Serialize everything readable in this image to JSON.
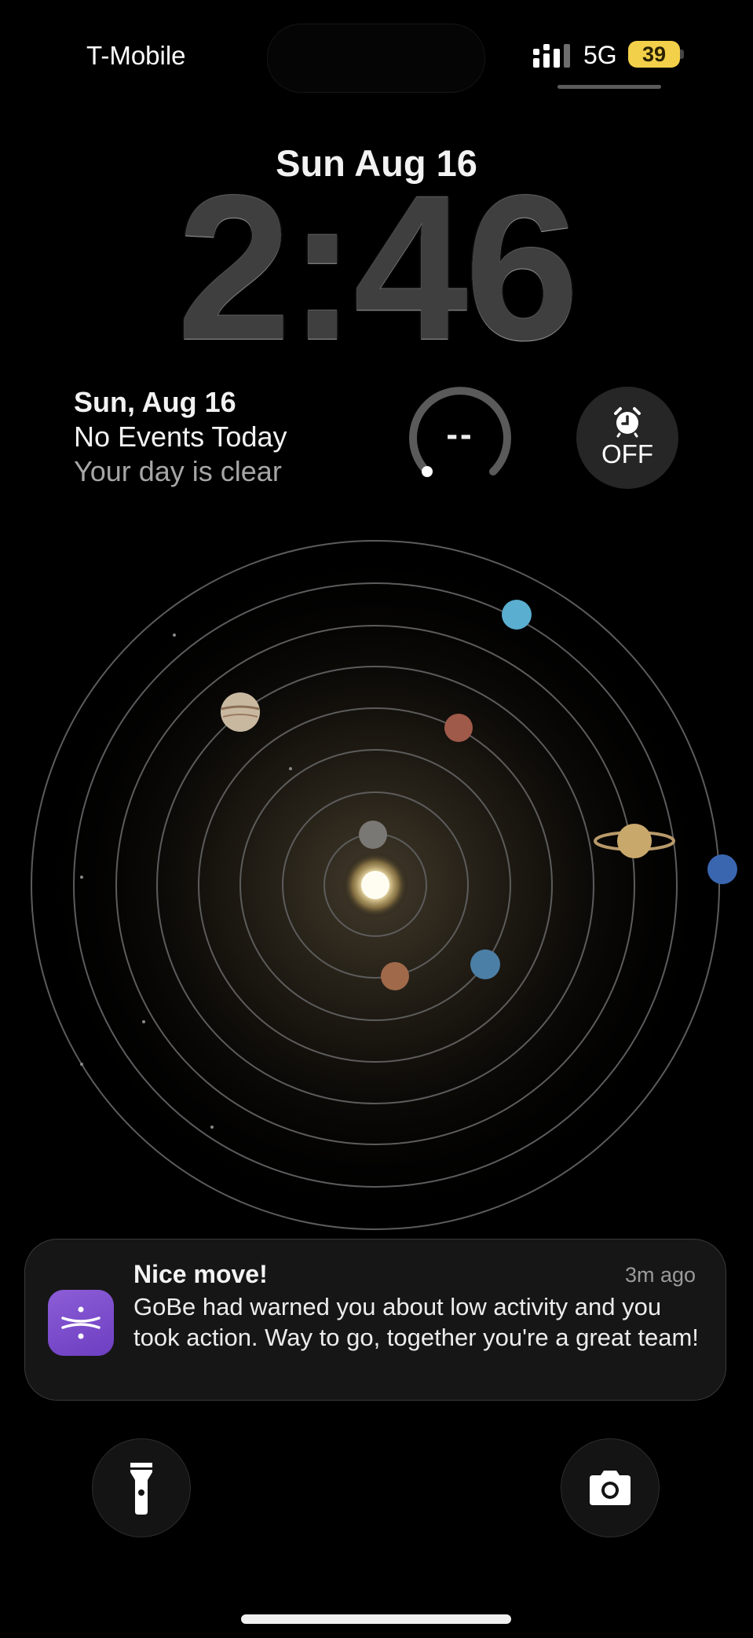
{
  "status_bar": {
    "carrier": "T-Mobile",
    "network": "5G",
    "battery": "39",
    "battery_color": "#f3d04a"
  },
  "lock_screen": {
    "date": "Sun Aug 16",
    "time": "2:46"
  },
  "widgets": {
    "calendar": {
      "date": "Sun, Aug 16",
      "events": "No Events Today",
      "subtitle": "Your day is clear"
    },
    "activity": {
      "value": "--"
    },
    "alarm": {
      "icon": "alarm-clock-icon",
      "label": "OFF"
    }
  },
  "wallpaper": {
    "theme": "solar-system",
    "bodies": [
      "sun",
      "mercury",
      "venus",
      "earth",
      "mars",
      "jupiter",
      "saturn",
      "uranus",
      "neptune"
    ]
  },
  "notification": {
    "app_icon": "gobe-app-icon",
    "accent": "#7c4dd0",
    "title": "Nice move!",
    "time": "3m ago",
    "body": "GoBe had warned you about low activity and you took action. Way to go, together you're a great team!"
  },
  "quick_actions": {
    "flashlight": {
      "icon": "flashlight-icon"
    },
    "camera": {
      "icon": "camera-icon"
    }
  }
}
